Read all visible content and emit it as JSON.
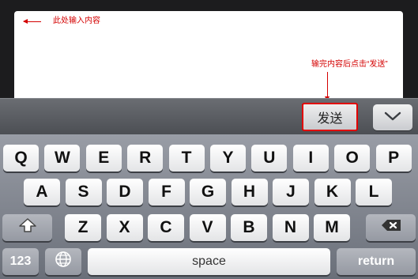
{
  "compose": {
    "hint": "此处输入内容"
  },
  "callout": {
    "text": "输完内容后点击“发送”"
  },
  "toolbar": {
    "send_label": "发送",
    "hide_keyboard_icon": "chevron-down-icon"
  },
  "keyboard": {
    "row1": [
      "Q",
      "W",
      "E",
      "R",
      "T",
      "Y",
      "U",
      "I",
      "O",
      "P"
    ],
    "row2": [
      "A",
      "S",
      "D",
      "F",
      "G",
      "H",
      "J",
      "K",
      "L"
    ],
    "row3": [
      "Z",
      "X",
      "C",
      "V",
      "B",
      "N",
      "M"
    ],
    "shift_icon": "shift-arrow-icon",
    "delete_icon": "backspace-icon",
    "numbers_label": "123",
    "globe_icon": "globe-icon",
    "space_label": "space",
    "return_label": "return"
  },
  "colors": {
    "annotation_red": "#d40000",
    "toolbar": "#5a5d62",
    "keyboard": "#858a93"
  }
}
